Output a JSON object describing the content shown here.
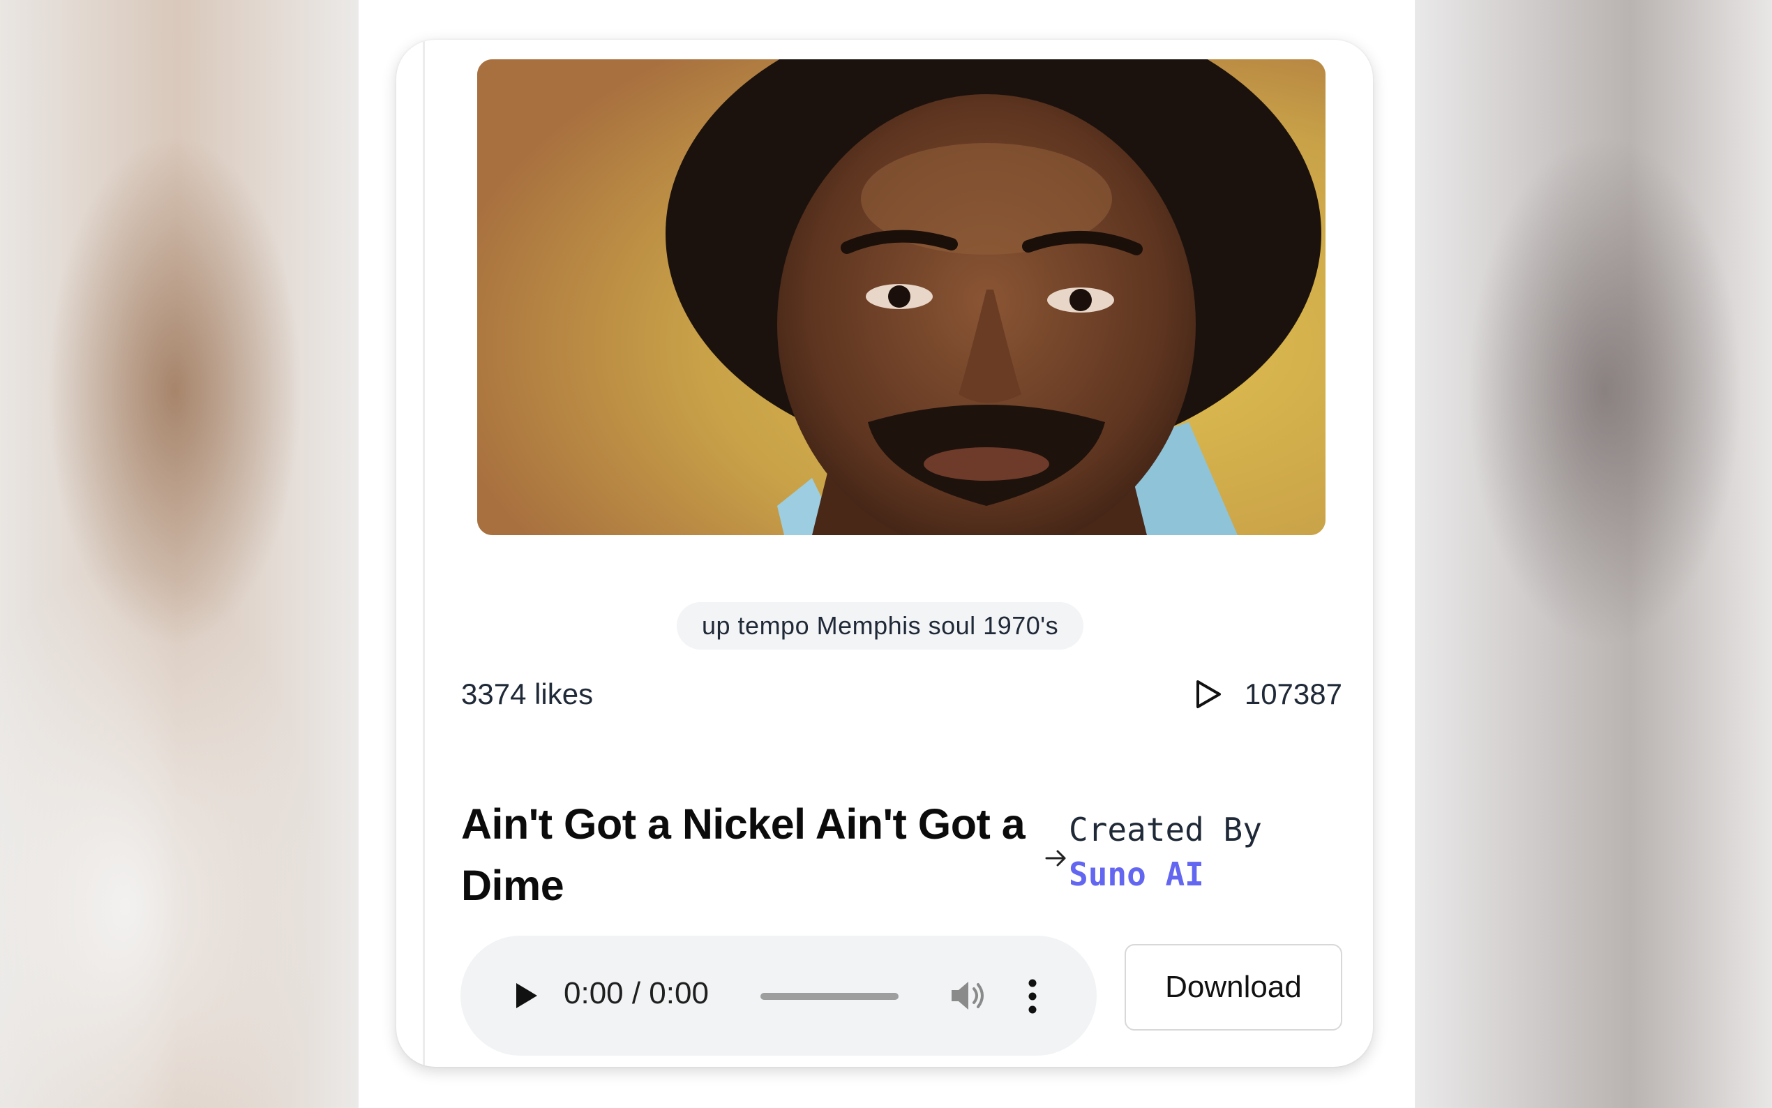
{
  "song": {
    "tags": "up tempo Memphis soul 1970's",
    "likes": "3374 likes",
    "plays": "107387",
    "title": "Ain't Got a Nickel Ain't Got a Dime",
    "created_by_label": "Created By",
    "creator_name": "Suno AI"
  },
  "player": {
    "time": "0:00 / 0:00"
  },
  "actions": {
    "download_label": "Download"
  },
  "colors": {
    "creator_link": "#6366f1",
    "chip_background": "#f3f4f6",
    "player_background": "#f1f3f4"
  },
  "icons": {
    "plays": "play-outline-icon",
    "creator": "arrow-right-icon",
    "player_play": "play-icon",
    "player_volume": "volume-icon",
    "player_menu": "more-vertical-icon"
  }
}
